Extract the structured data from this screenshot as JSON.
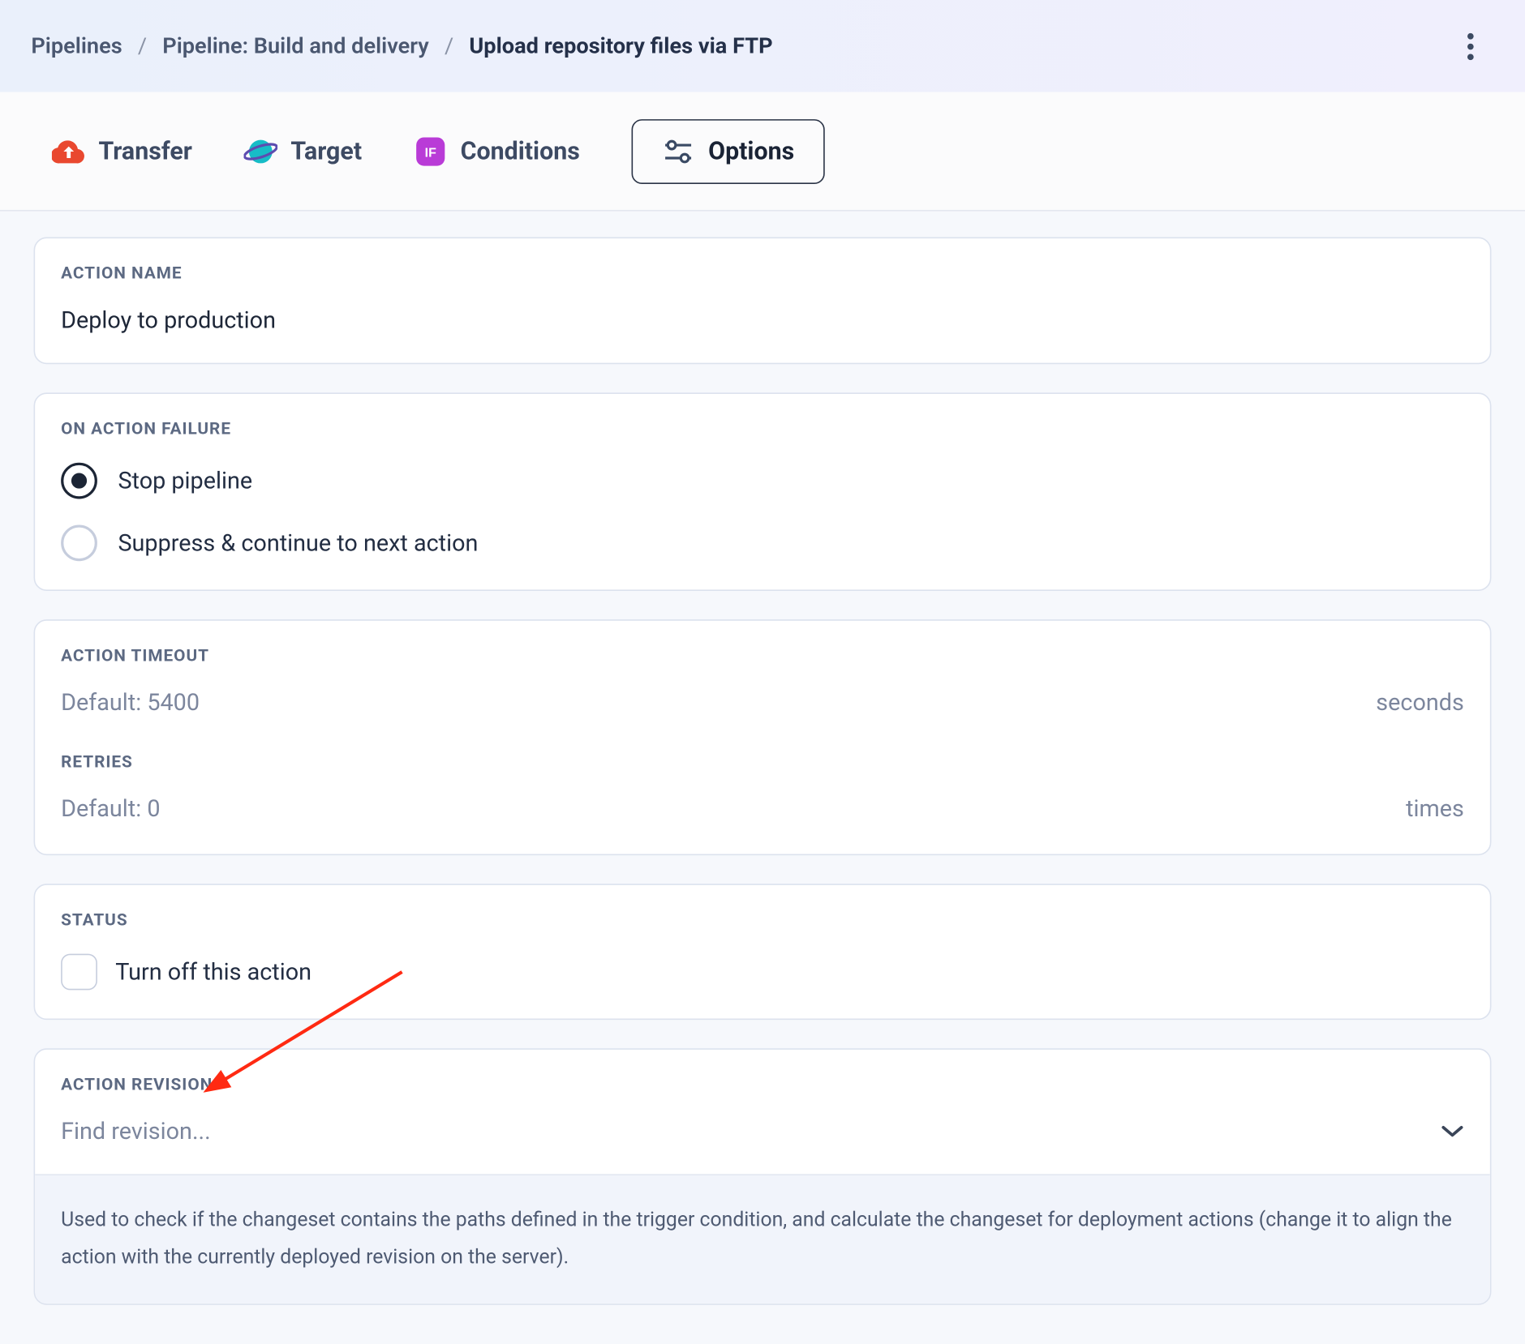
{
  "breadcrumb": {
    "root": "Pipelines",
    "pipeline": "Pipeline: Build and delivery",
    "current": "Upload repository files via FTP"
  },
  "tabs": {
    "transfer": "Transfer",
    "target": "Target",
    "conditions": "Conditions",
    "options": "Options"
  },
  "action_name": {
    "label": "ACTION NAME",
    "value": "Deploy to production"
  },
  "failure": {
    "label": "ON ACTION FAILURE",
    "stop": "Stop pipeline",
    "suppress": "Suppress & continue to next action"
  },
  "timeout": {
    "label": "ACTION TIMEOUT",
    "placeholder": "Default: 5400",
    "unit": "seconds"
  },
  "retries": {
    "label": "RETRIES",
    "placeholder": "Default: 0",
    "unit": "times"
  },
  "status": {
    "label": "STATUS",
    "turn_off": "Turn off this action"
  },
  "revision": {
    "label": "ACTION REVISION",
    "placeholder": "Find revision...",
    "help": "Used to check if the changeset contains the paths defined in the trigger condition, and calculate the changeset for deployment actions (change it to align the action with the currently deployed revision on the server)."
  }
}
